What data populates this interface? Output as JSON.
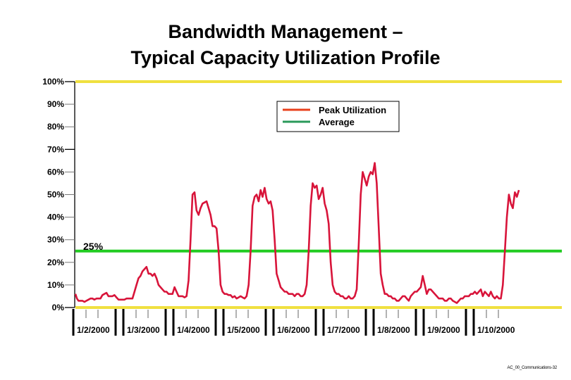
{
  "chart_data": {
    "type": "line",
    "title_line1": "Bandwidth Management –",
    "title_line2": "Typical Capacity Utilization Profile",
    "xlabel": "",
    "ylabel": "",
    "ylim": [
      0,
      100
    ],
    "y_ticks": [
      "0%",
      "10%",
      "20%",
      "30%",
      "40%",
      "50%",
      "60%",
      "70%",
      "80%",
      "90%",
      "100%"
    ],
    "y_tick_values": [
      0,
      10,
      20,
      30,
      40,
      50,
      60,
      70,
      80,
      90,
      100
    ],
    "x_ticks": [
      "1/2/2000",
      "1/3/2000",
      "1/4/2000",
      "1/5/2000",
      "1/6/2000",
      "1/7/2000",
      "1/8/2000",
      "1/9/2000",
      "1/10/2000"
    ],
    "grid": false,
    "legend": {
      "placement": "top-right",
      "entries": [
        {
          "label": "Peak Utilization",
          "color": "#e8401c"
        },
        {
          "label": "Average",
          "color": "#2a9a5a"
        }
      ]
    },
    "reference_lines": [
      {
        "name": "capacity-max",
        "value": 100,
        "color": "#f0e040"
      },
      {
        "name": "capacity-min",
        "value": 0,
        "color": "#f0e040"
      },
      {
        "name": "average",
        "value": 25,
        "color": "#22cc22",
        "label": "25%"
      }
    ],
    "series": [
      {
        "name": "Peak Utilization",
        "color": "#d8143a",
        "x_unit": "days since 1/2/2000",
        "x": [
          0.0,
          0.03,
          0.06,
          0.1,
          0.14,
          0.18,
          0.22,
          0.26,
          0.3,
          0.34,
          0.38,
          0.42,
          0.46,
          0.5,
          0.54,
          0.58,
          0.62,
          0.66,
          0.7,
          0.74,
          0.78,
          0.82,
          0.86,
          0.9,
          0.94,
          0.98,
          1.02,
          1.06,
          1.1,
          1.14,
          1.18,
          1.22,
          1.26,
          1.3,
          1.34,
          1.38,
          1.42,
          1.46,
          1.5,
          1.54,
          1.58,
          1.62,
          1.66,
          1.7,
          1.74,
          1.78,
          1.82,
          1.86,
          1.9,
          1.94,
          1.98,
          2.02,
          2.06,
          2.1,
          2.14,
          2.18,
          2.22,
          2.26,
          2.3,
          2.34,
          2.38,
          2.42,
          2.46,
          2.5,
          2.54,
          2.58,
          2.62,
          2.66,
          2.7,
          2.74,
          2.78,
          2.82,
          2.86,
          2.9,
          2.94,
          2.98,
          3.02,
          3.06,
          3.1,
          3.14,
          3.18,
          3.22,
          3.26,
          3.3,
          3.34,
          3.38,
          3.42,
          3.46,
          3.5,
          3.54,
          3.58,
          3.62,
          3.66,
          3.7,
          3.74,
          3.78,
          3.82,
          3.86,
          3.9,
          3.94,
          3.98,
          4.02,
          4.06,
          4.1,
          4.14,
          4.18,
          4.22,
          4.26,
          4.3,
          4.34,
          4.38,
          4.42,
          4.46,
          4.5,
          4.54,
          4.58,
          4.62,
          4.66,
          4.7,
          4.74,
          4.78,
          4.82,
          4.86,
          4.9,
          4.94,
          4.98,
          5.02,
          5.06,
          5.1,
          5.14,
          5.18,
          5.22,
          5.26,
          5.3,
          5.34,
          5.38,
          5.42,
          5.46,
          5.5,
          5.54,
          5.58,
          5.62,
          5.66,
          5.7,
          5.74,
          5.78,
          5.82,
          5.86,
          5.9,
          5.94,
          5.98,
          6.02,
          6.06,
          6.1,
          6.14,
          6.18,
          6.22,
          6.26,
          6.3,
          6.34,
          6.38,
          6.42,
          6.46,
          6.5,
          6.54,
          6.58,
          6.62,
          6.66,
          6.7,
          6.74,
          6.78,
          6.82,
          6.86,
          6.9,
          6.94,
          6.98,
          7.02,
          7.06,
          7.1,
          7.14,
          7.18,
          7.22,
          7.26,
          7.3,
          7.34,
          7.38,
          7.42,
          7.46,
          7.5,
          7.54,
          7.58,
          7.62,
          7.66,
          7.7,
          7.74,
          7.78,
          7.82,
          7.86,
          7.9,
          7.94,
          7.98,
          8.02,
          8.06,
          8.1,
          8.14,
          8.18,
          8.22,
          8.26,
          8.3,
          8.34,
          8.38
        ],
        "y": [
          6,
          4,
          3,
          3,
          3,
          2.5,
          3,
          3.5,
          4,
          4,
          3.5,
          4,
          4,
          4,
          5.5,
          6,
          6.5,
          5,
          5,
          5,
          5.5,
          4.5,
          3.5,
          3.5,
          3.5,
          3.5,
          4,
          4,
          4,
          4,
          7,
          10,
          13,
          14,
          16,
          17,
          18,
          15,
          15,
          14,
          15,
          13,
          10,
          9,
          8,
          7,
          7,
          6,
          6,
          6,
          9,
          7,
          5,
          5,
          5,
          4.5,
          5,
          12,
          30,
          50,
          51,
          43,
          41,
          44,
          46,
          46.5,
          47,
          44,
          41,
          36,
          36,
          35,
          25,
          10,
          7,
          6,
          6,
          5.5,
          5.5,
          4.5,
          5,
          4,
          4.5,
          5,
          4.5,
          4,
          5,
          10,
          25,
          45,
          49,
          50,
          47,
          52,
          49,
          53,
          48,
          46,
          47,
          43,
          30,
          15,
          12,
          9,
          8,
          7,
          7,
          6,
          6,
          6,
          5,
          6,
          6,
          5,
          5,
          6,
          10,
          25,
          45,
          55,
          53,
          54,
          48,
          50,
          53,
          46,
          43,
          37,
          20,
          10,
          7,
          6,
          6,
          5,
          5,
          4,
          4,
          5,
          4,
          4,
          5,
          8,
          28,
          50,
          60,
          57,
          54,
          58,
          60,
          59,
          64,
          55,
          35,
          15,
          10,
          6,
          6,
          5,
          5,
          4,
          4,
          3,
          3,
          4,
          5,
          5,
          4,
          3,
          5,
          6,
          7,
          7,
          8,
          9,
          14,
          10,
          6,
          8,
          8,
          7,
          6,
          5,
          4,
          4,
          4,
          3,
          3,
          4,
          4,
          3,
          2.5,
          2,
          3,
          4,
          4,
          5,
          5,
          5,
          6,
          6,
          7,
          6,
          7,
          8,
          5,
          7,
          6,
          5,
          7,
          5,
          4
        ]
      }
    ],
    "series_tail": {
      "x": [
        8.42,
        8.46,
        8.5,
        8.54,
        8.58,
        8.62,
        8.66,
        8.7,
        8.74,
        8.78,
        8.82,
        8.86
      ],
      "y": [
        5,
        4,
        4,
        10,
        25,
        40,
        50,
        46,
        44,
        51,
        49,
        52
      ]
    }
  },
  "footer": "AC_00_Communications-32"
}
